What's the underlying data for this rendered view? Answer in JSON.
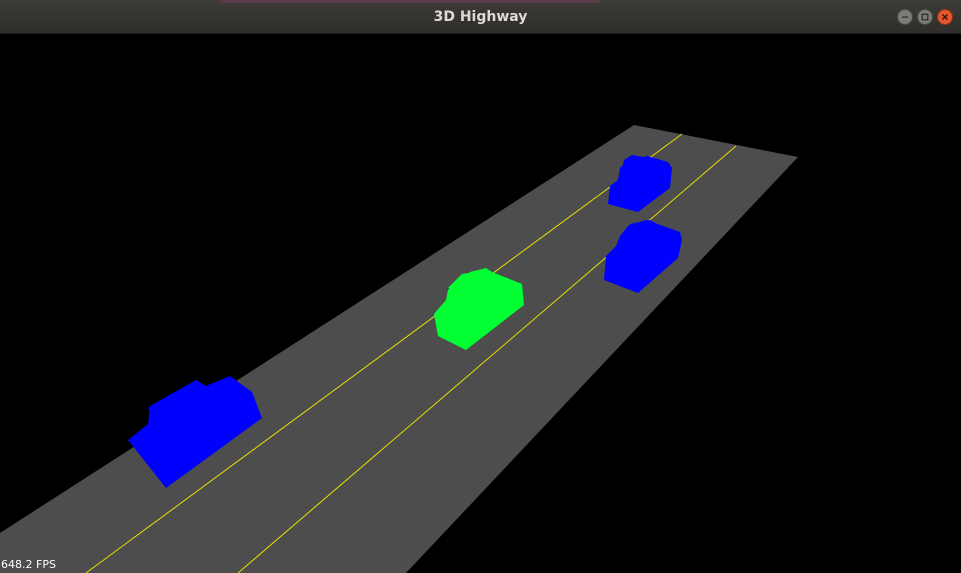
{
  "window": {
    "title": "3D Highway",
    "buttons": [
      "minimize",
      "maximize",
      "close"
    ]
  },
  "scene": {
    "road_color": "#4d4d4d",
    "lane_line_color": "#e5e000",
    "background_color": "#000000",
    "player_car_color": "#00ff33",
    "traffic_car_color": "#0000ff",
    "traffic_count": 3
  },
  "hud": {
    "fps_label": "648.2 FPS"
  },
  "colors": {
    "titlebar": "#3c3b37",
    "close_button": "#e2572b"
  }
}
